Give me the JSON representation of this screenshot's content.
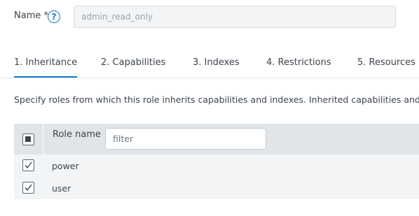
{
  "name_field": {
    "label": "Name *",
    "help_icon": "question-circle-icon",
    "placeholder": "admin_read_only"
  },
  "tabs": [
    {
      "label": "1. Inheritance",
      "active": true
    },
    {
      "label": "2. Capabilities",
      "active": false
    },
    {
      "label": "3. Indexes",
      "active": false
    },
    {
      "label": "4. Restrictions",
      "active": false
    },
    {
      "label": "5. Resources",
      "active": false
    }
  ],
  "description": "Specify roles from which this role inherits capabilities and indexes. Inherited capabilities and in",
  "roles_table": {
    "header_label": "Role name",
    "filter_placeholder": "filter",
    "select_all_state": "partial",
    "rows": [
      {
        "label": "power",
        "checked": true
      },
      {
        "label": "user",
        "checked": true
      }
    ]
  },
  "colors": {
    "accent": "#1a78c2",
    "header_bg": "#e1e5e8",
    "row_bg": "#f2f4f5"
  }
}
